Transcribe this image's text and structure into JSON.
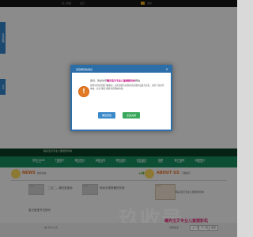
{
  "topbar": {
    "favorite": "加入收藏",
    "login": "会员",
    "language": "语言"
  },
  "side_tabs": {
    "online_service": "在线客服",
    "share": "分享"
  },
  "banner": {
    "logo_text": "曦亮宝贝专业儿童摄影机构"
  },
  "nav": {
    "items": [
      {
        "cn": "首页HOME",
        "en": "HOME"
      },
      {
        "cn": "了解我们",
        "en": "ABOUT"
      },
      {
        "cn": "服务项目",
        "en": "SERVICE"
      },
      {
        "cn": "最新动态",
        "en": "NEWS"
      },
      {
        "cn": "联系我们",
        "en": "CONTACT"
      },
      {
        "cn": "在线留言",
        "en": "MESSAGE"
      },
      {
        "cn": "招聘",
        "en": "JOBS"
      },
      {
        "cn": "客户案例",
        "en": "CASES"
      },
      {
        "cn": "我要预约",
        "en": "ORDER"
      }
    ]
  },
  "news": {
    "title": "NEWS",
    "subtitle": "最新动态",
    "more": "+MORE",
    "thumb_label": "Photo",
    "items": [
      "二月二，我的宝宝帅",
      "妈妈手里常备的东西",
      "宝贝宝宝节日快乐"
    ]
  },
  "about": {
    "title": "ABOUT US",
    "subtitle": "了解我们",
    "image_label": "Photo",
    "text": "曦亮宝贝专业儿童摄影机构"
  },
  "footer": {
    "page_info": "第1页 共1页",
    "pager_prev": "上一页",
    "pager_next": "下一页",
    "pager_last": "尾页",
    "right_info": "查看更多"
  },
  "watermark": {
    "text": "玖收录"
  },
  "brand": {
    "text": "曦亮宝贝专业儿童摄影机"
  },
  "dialog": {
    "title": "来自网页的消息",
    "close": "×",
    "line1_prefix": "您好，欢迎访问",
    "line1_highlight": "曦亮宝贝专业儿童摄影机构",
    "line1_suffix": "网站",
    "body": "您所访问的页面已被收录，如有需要可在您的浏览器中设置为首页，方便下次访问本站。点击\"确定\"继续浏览网站内容。",
    "ok": "确定按钮",
    "cancel": "点此关闭",
    "icon": "warning-icon"
  },
  "colors": {
    "nav_green": "#17885a",
    "dialog_blue": "#2c6ea8",
    "accent_orange": "#e06c1f",
    "side_blue": "#2f7fc2"
  }
}
